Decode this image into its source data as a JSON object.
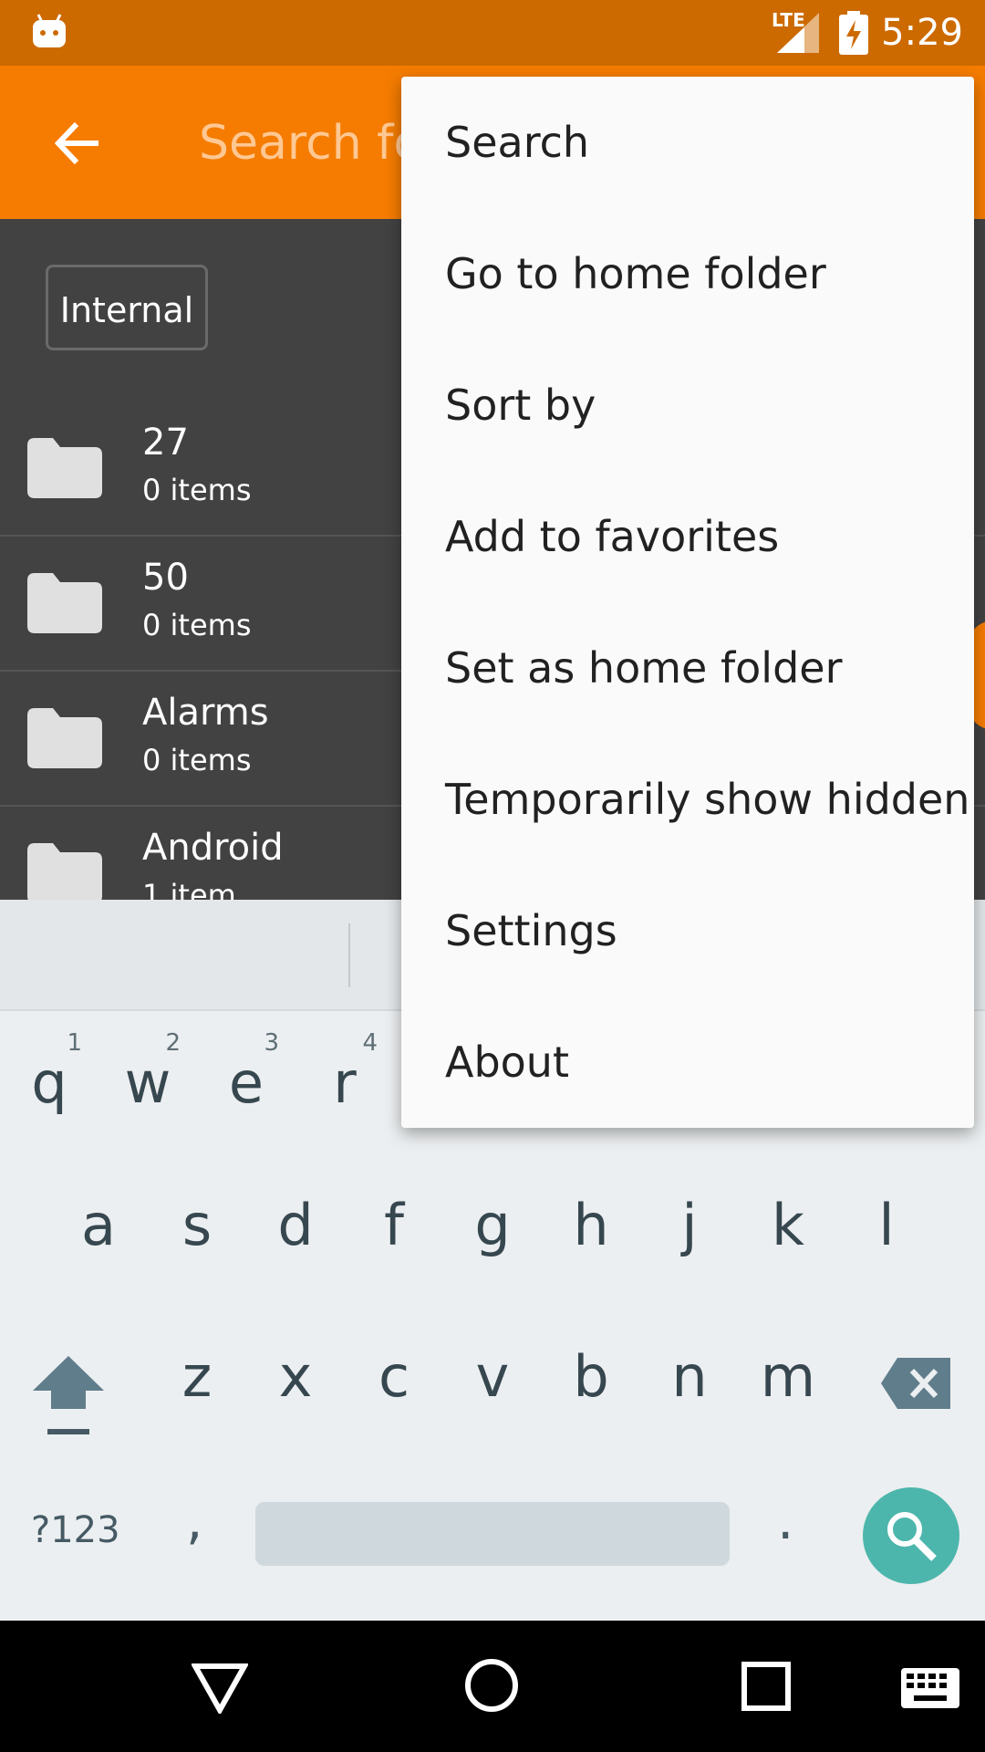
{
  "status_bar": {
    "time": "5:29",
    "network": "LTE"
  },
  "toolbar": {
    "search_placeholder": "Search folder"
  },
  "storage_chip": "Internal",
  "folders": [
    {
      "name": "27",
      "count": "0 items"
    },
    {
      "name": "50",
      "count": "0 items"
    },
    {
      "name": "Alarms",
      "count": "0 items"
    },
    {
      "name": "Android",
      "count": "1 item"
    }
  ],
  "menu": {
    "items": [
      "Search",
      "Go to home folder",
      "Sort by",
      "Add to favorites",
      "Set as home folder",
      "Temporarily show hidden",
      "Settings",
      "About"
    ]
  },
  "keyboard": {
    "row1": [
      "q",
      "w",
      "e",
      "r"
    ],
    "row1_hints": [
      "1",
      "2",
      "3",
      "4"
    ],
    "row2": [
      "a",
      "s",
      "d",
      "f",
      "g",
      "h",
      "j",
      "k",
      "l"
    ],
    "row3": [
      "z",
      "x",
      "c",
      "v",
      "b",
      "n",
      "m"
    ],
    "symbols_label": "?123",
    "comma": ",",
    "period": "."
  },
  "colors": {
    "status_bar": "#CC6A00",
    "app_bar": "#F57C00",
    "list_background": "#424242",
    "menu_background": "#FAFAFA",
    "keyboard_background": "#ECEFF1",
    "search_key": "#4DB6AC"
  }
}
